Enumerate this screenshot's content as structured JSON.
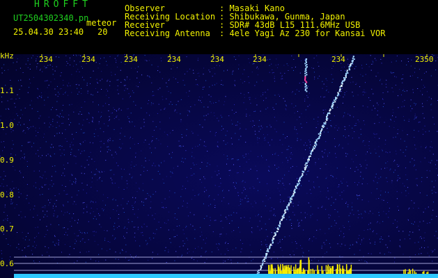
{
  "header": {
    "brand": "HROFFT",
    "filename": "UT2504302340.pn",
    "meteor_label": "meteor",
    "timestamp": "25.04.30 23:40",
    "meteor_count": "20",
    "info": [
      {
        "key": "Observer",
        "value": ": Masaki Kano"
      },
      {
        "key": "Receiving Location",
        "value": ": Shibukawa, Gunma, Japan"
      },
      {
        "key": "Receiver",
        "value": ": SDR# 43dB L15 111.6MHz USB"
      },
      {
        "key": "Receiving Antenna",
        "value": ": 4ele Yagi Az 230 for Kansai VOR"
      }
    ]
  },
  "axes": {
    "unit": "kHz",
    "y_ticks": [
      "1.1",
      "1.0",
      "0.9",
      "0.8",
      "0.7",
      "0.6"
    ],
    "x_ticks": [
      "234",
      "234",
      "234",
      "234",
      "234",
      "234",
      "234",
      "2350"
    ]
  },
  "colors": {
    "text_header": "#1fd11f",
    "text_axis": "#f2f200",
    "background": "#03032a",
    "signal": "#9fd6ff",
    "echo": "#f7ec00",
    "baseline": "#2ec8ff"
  }
}
